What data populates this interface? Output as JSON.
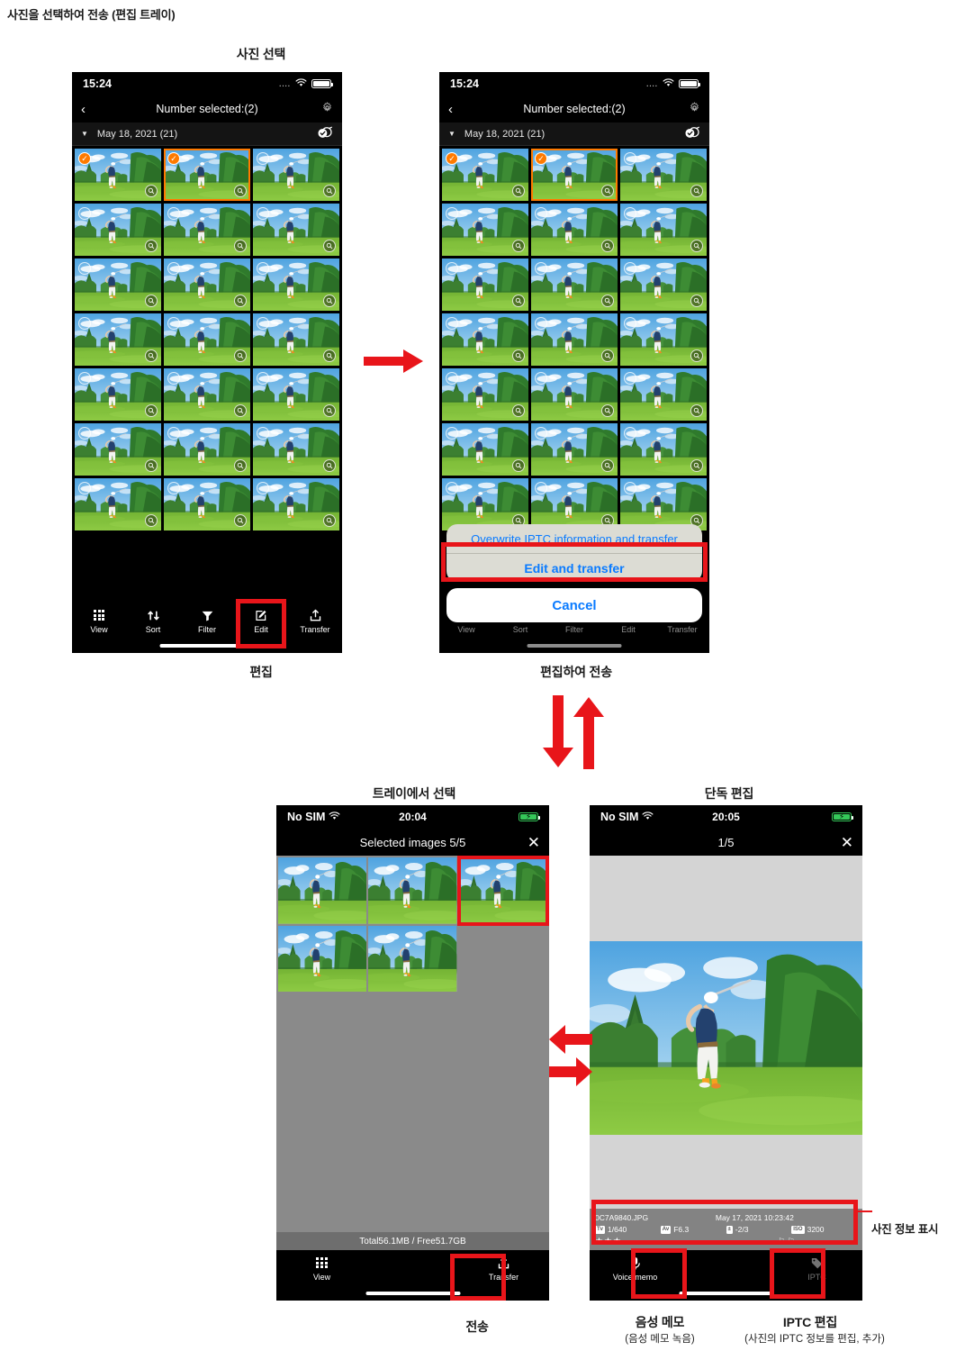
{
  "page": {
    "title": "사진을 선택하여 전송 (편집 트레이)"
  },
  "steps": {
    "select_photo": "사진 선택",
    "edit": "편집",
    "edit_and_transfer": "편집하여 전송",
    "select_from_tray": "트레이에서 선택",
    "single_edit": "단독 편집",
    "transfer": "전송",
    "voice_memo": "음성 메모",
    "voice_memo_sub": "(음성 메모 녹음)",
    "iptc_edit": "IPTC 편집",
    "iptc_edit_sub": "(사진의 IPTC 정보를 편집, 추가)",
    "photo_info_display": "사진 정보 표시"
  },
  "phone1": {
    "status": {
      "time": "15:24",
      "dots": "....",
      "wifi": "wifi-icon",
      "battery": "battery-icon"
    },
    "nav": {
      "back": "‹",
      "title": "Number selected:(2)",
      "settings": "gear-icon"
    },
    "datebar": {
      "caret": "▼",
      "label": "May 18, 2021 (21)",
      "select_all": "select-all-icon"
    },
    "tabs": [
      {
        "name": "view",
        "label": "View",
        "icon": "grid-icon"
      },
      {
        "name": "sort",
        "label": "Sort",
        "icon": "sort-arrows-icon"
      },
      {
        "name": "filter",
        "label": "Filter",
        "icon": "funnel-icon"
      },
      {
        "name": "edit",
        "label": "Edit",
        "icon": "pencil-square-icon"
      },
      {
        "name": "transfer",
        "label": "Transfer",
        "icon": "upload-icon"
      }
    ],
    "grid": {
      "rows": 7,
      "cols": 3,
      "selected_indices": [
        0,
        1
      ],
      "focused_index": 1
    }
  },
  "phone2": {
    "status": {
      "time": "15:24",
      "dots": "....",
      "wifi": "wifi-icon",
      "battery": "battery-icon"
    },
    "nav": {
      "back": "‹",
      "title": "Number selected:(2)",
      "settings": "gear-icon"
    },
    "datebar": {
      "caret": "▼",
      "label": "May 18, 2021 (21)",
      "select_all": "select-all-icon"
    },
    "sheet": {
      "options": [
        "Overwrite IPTC information and transfer",
        "Edit and transfer"
      ],
      "cancel": "Cancel"
    },
    "tabs": [
      {
        "name": "view",
        "label": "View"
      },
      {
        "name": "sort",
        "label": "Sort"
      },
      {
        "name": "filter",
        "label": "Filter"
      },
      {
        "name": "edit",
        "label": "Edit"
      },
      {
        "name": "transfer",
        "label": "Transfer"
      }
    ]
  },
  "phone3": {
    "status": {
      "carrier": "No SIM",
      "wifi": "wifi-icon",
      "time": "20:04",
      "battery": "battery-charging-icon"
    },
    "nav": {
      "title": "Selected images 5/5",
      "close": "✕"
    },
    "tray": {
      "count": 5,
      "selected_index": 2
    },
    "footer": "Total56.1MB / Free51.7GB",
    "tabs": [
      {
        "name": "view",
        "label": "View",
        "icon": "grid-icon"
      },
      {
        "name": "transfer",
        "label": "Transfer",
        "icon": "upload-icon"
      }
    ]
  },
  "phone4": {
    "status": {
      "carrier": "No SIM",
      "wifi": "wifi-icon",
      "time": "20:05",
      "battery": "battery-charging-icon"
    },
    "nav": {
      "title": "1/5",
      "close": "✕"
    },
    "exif": {
      "filename": "0C7A9840.JPG",
      "datetime": "May 17, 2021 10:23:42",
      "shutter_tag": "Tv",
      "shutter": "1/640",
      "aperture_tag": "Av",
      "aperture": "F6.3",
      "exposure_tag": "exposure-comp-icon",
      "exposure": "-2/3",
      "iso_tag": "ISO",
      "iso": "3200",
      "rating": "★★★",
      "marks": "⚐ ⚐"
    },
    "tabs": [
      {
        "name": "voice-memo",
        "label": "Voice memo",
        "icon": "microphone-icon"
      },
      {
        "name": "spacer",
        "label": "",
        "icon": ""
      },
      {
        "name": "iptc",
        "label": "IPTC",
        "icon": "tag-icon"
      }
    ]
  },
  "colors": {
    "highlight": "#e8151a",
    "selection": "#ff7a00",
    "ios_blue": "#0a7bff",
    "battery_green": "#35c759"
  }
}
